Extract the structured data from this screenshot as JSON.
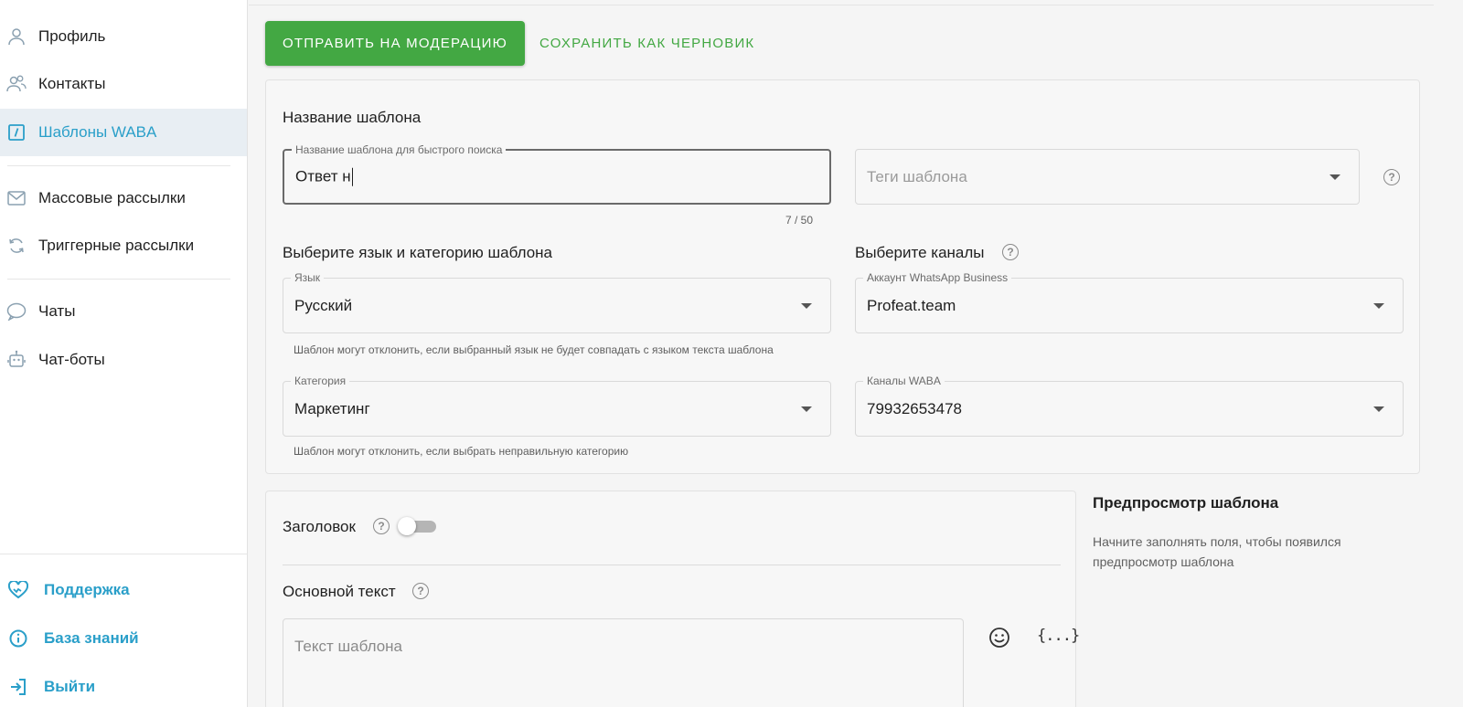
{
  "sidebar": {
    "items": [
      {
        "label": "Профиль",
        "icon": "user-icon"
      },
      {
        "label": "Контакты",
        "icon": "contacts-icon"
      },
      {
        "label": "Шаблоны WABA",
        "icon": "template-icon"
      },
      {
        "label": "Массовые рассылки",
        "icon": "mail-icon"
      },
      {
        "label": "Триггерные рассылки",
        "icon": "refresh-icon"
      },
      {
        "label": "Чаты",
        "icon": "chat-icon"
      },
      {
        "label": "Чат-боты",
        "icon": "bot-icon"
      }
    ],
    "bottom_items": [
      {
        "label": "Поддержка",
        "icon": "support-heart-icon"
      },
      {
        "label": "База знаний",
        "icon": "info-icon"
      },
      {
        "label": "Выйти",
        "icon": "logout-icon"
      }
    ],
    "active_item": "Шаблоны WABA"
  },
  "toolbar": {
    "submit_label": "ОТПРАВИТЬ НА МОДЕРАЦИЮ",
    "draft_label": "СОХРАНИТЬ КАК ЧЕРНОВИК"
  },
  "template_name": {
    "section_title": "Название шаблона",
    "name_field_label": "Название шаблона для быстрого поиска",
    "name_value": "Ответ н",
    "counter": "7 / 50",
    "tags_placeholder": "Теги шаблона"
  },
  "language_category": {
    "section_title": "Выберите язык и категорию шаблона",
    "language_label": "Язык",
    "language_value": "Русский",
    "language_hint": "Шаблон могут отклонить, если выбранный язык не будет совпадать с языком текста шаблона",
    "category_label": "Категория",
    "category_value": "Маркетинг",
    "category_hint": "Шаблон могут отклонить, если выбрать неправильную категорию"
  },
  "channels": {
    "section_title": "Выберите каналы",
    "account_label": "Аккаунт WhatsApp Business",
    "account_value": "Profeat.team",
    "waba_label": "Каналы WABA",
    "waba_value": "79932653478"
  },
  "content": {
    "header_label": "Заголовок",
    "header_enabled": false,
    "body_label": "Основной текст",
    "body_placeholder": "Текст шаблона",
    "vars_symbol": "{...}"
  },
  "preview": {
    "title": "Предпросмотр шаблона",
    "text": "Начните заполнять поля, чтобы появился предпросмотр шаблона"
  },
  "colors": {
    "accent_green": "#43a843",
    "accent_blue": "#2a9fc9",
    "active_bg": "#e8eef3"
  }
}
